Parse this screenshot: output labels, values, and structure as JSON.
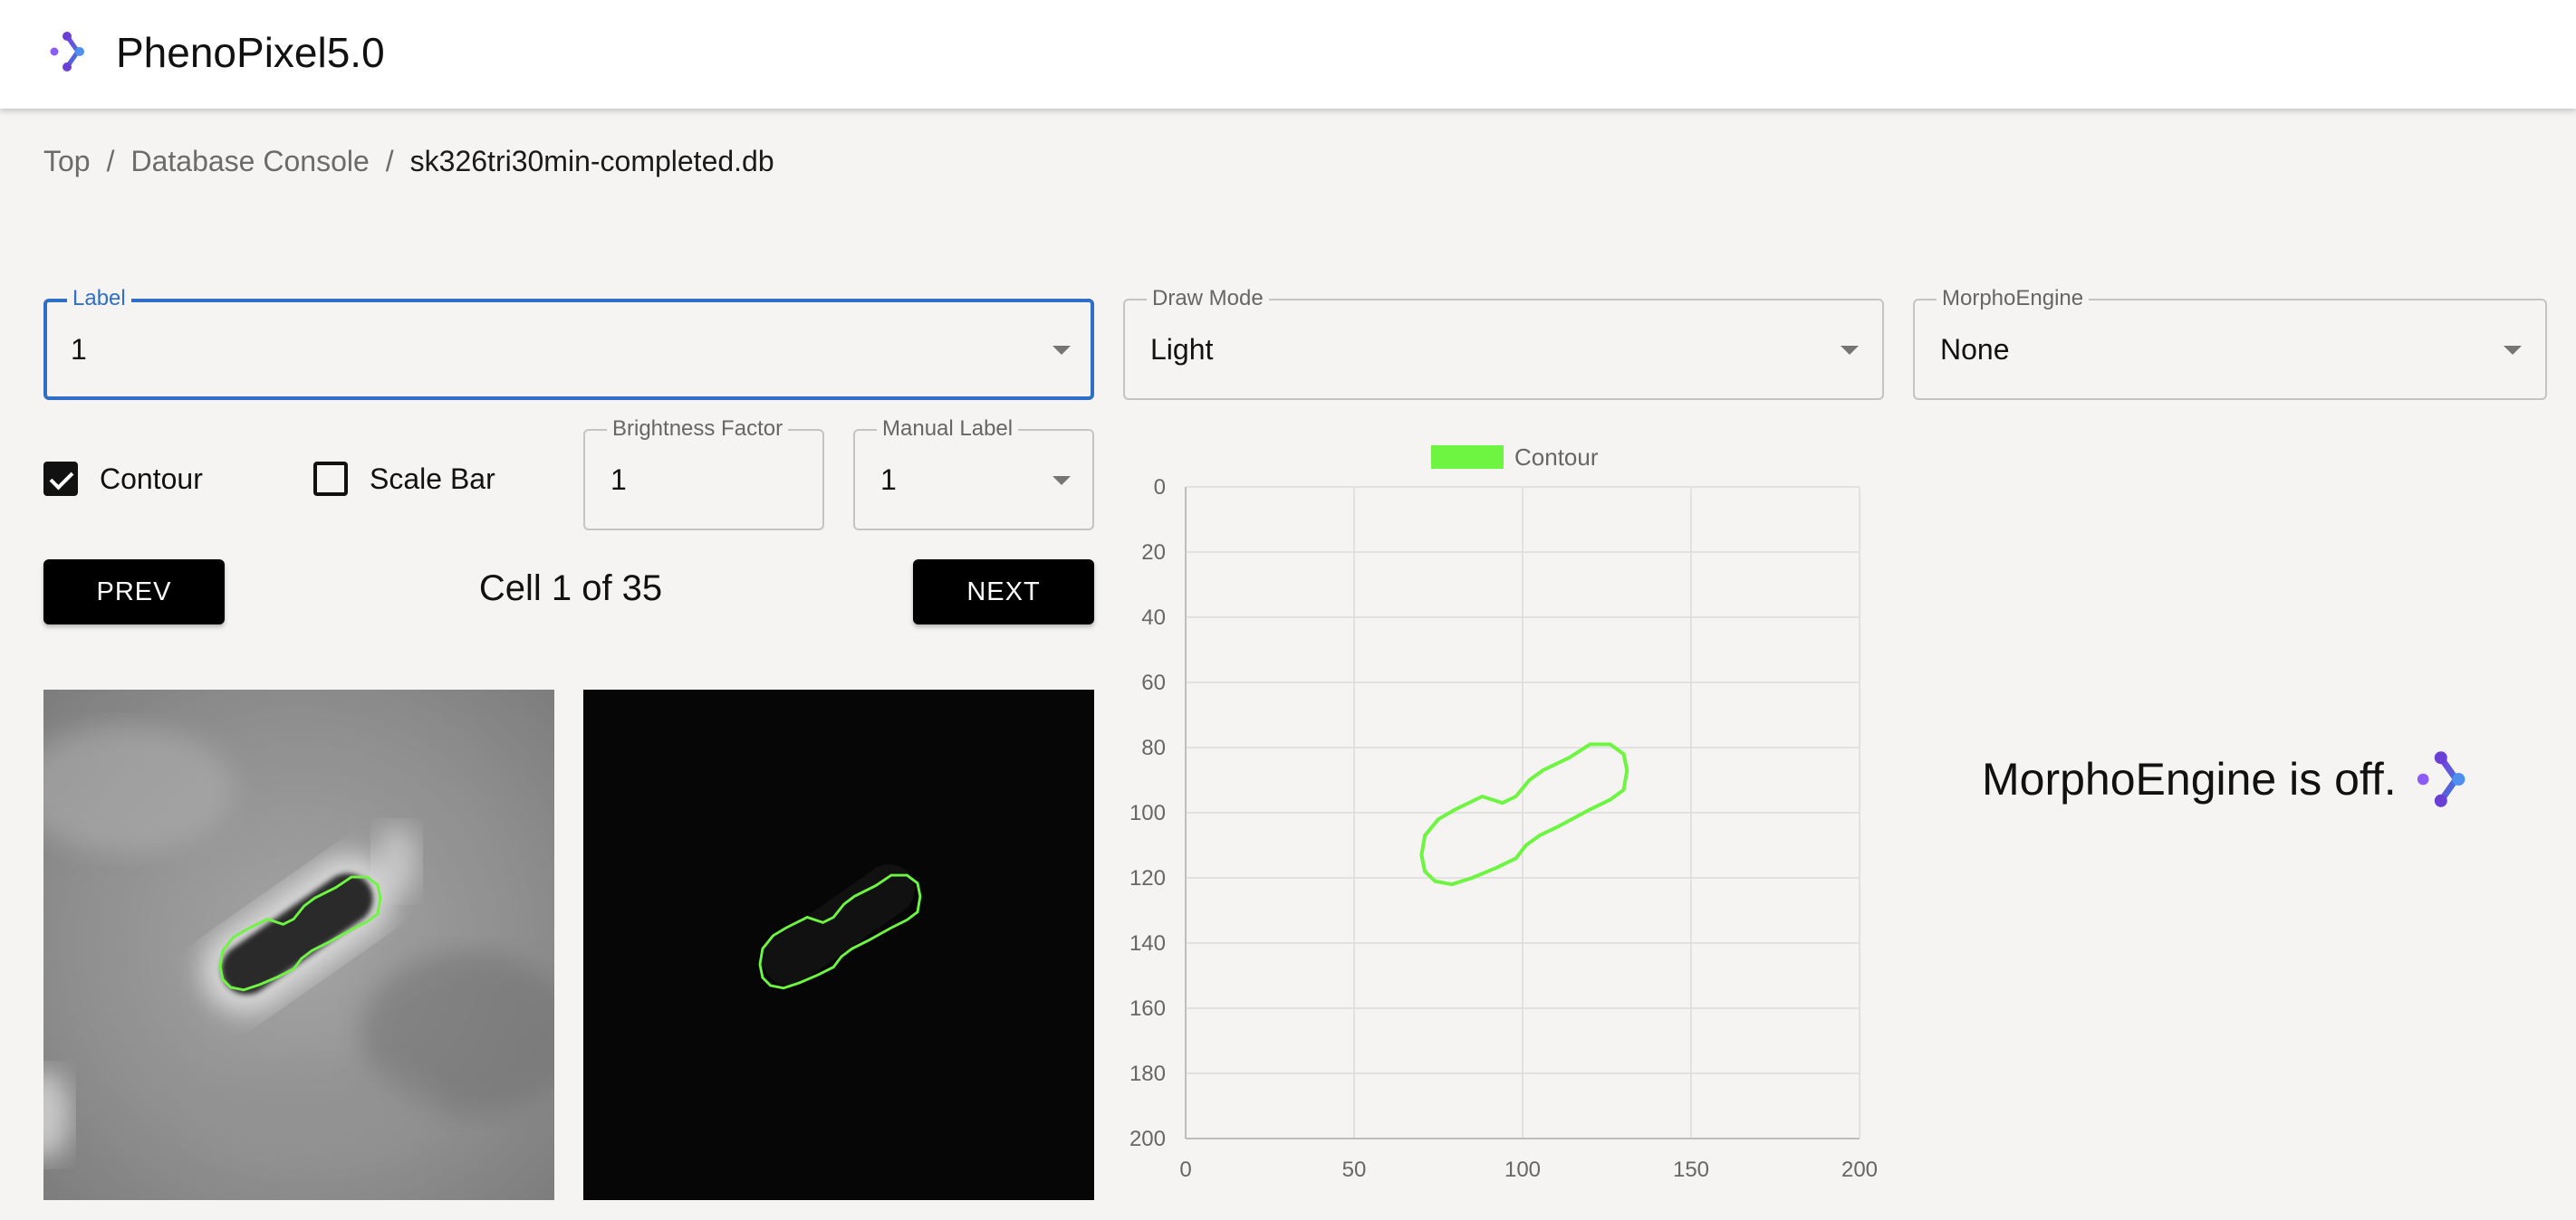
{
  "app": {
    "title": "PhenoPixel5.0",
    "logo_icon": "phenopixel-logo-icon"
  },
  "breadcrumb": {
    "items": [
      "Top",
      "Database Console",
      "sk326tri30min-completed.db"
    ],
    "separator": "/"
  },
  "controls": {
    "label": {
      "label": "Label",
      "value": "1"
    },
    "draw_mode": {
      "label": "Draw Mode",
      "value": "Light"
    },
    "morpho_engine": {
      "label": "MorphoEngine",
      "value": "None"
    },
    "contour": {
      "label": "Contour",
      "checked": true
    },
    "scale_bar": {
      "label": "Scale Bar",
      "checked": false
    },
    "brightness": {
      "label": "Brightness Factor",
      "value": "1"
    },
    "manual_label": {
      "label": "Manual Label",
      "value": "1"
    }
  },
  "navigation": {
    "prev_label": "PREV",
    "next_label": "NEXT",
    "counter_text": "Cell 1 of 35"
  },
  "morpho_status": {
    "text": "MorphoEngine is off."
  },
  "colors": {
    "accent": "#2f6fc7",
    "contour": "#6ef542",
    "button": "#000000",
    "background": "#f5f4f2"
  },
  "chart_data": {
    "type": "line",
    "legend": [
      "Contour"
    ],
    "legend_position": "top",
    "xlim": [
      0,
      200
    ],
    "ylim": [
      0,
      200
    ],
    "y_inverted": true,
    "grid": true,
    "x_ticks": [
      "0",
      "50",
      "100",
      "150",
      "200"
    ],
    "y_ticks": [
      "0",
      "20",
      "40",
      "60",
      "80",
      "100",
      "120",
      "140",
      "160",
      "180",
      "200"
    ],
    "series": [
      {
        "name": "Contour",
        "closed": true,
        "points": [
          [
            71,
            107
          ],
          [
            75,
            102
          ],
          [
            80,
            99
          ],
          [
            88,
            95
          ],
          [
            94,
            97
          ],
          [
            98,
            95
          ],
          [
            102,
            90
          ],
          [
            106,
            87
          ],
          [
            114,
            83
          ],
          [
            120,
            79
          ],
          [
            126,
            79
          ],
          [
            130,
            82
          ],
          [
            131,
            87
          ],
          [
            130,
            93
          ],
          [
            126,
            96
          ],
          [
            120,
            99
          ],
          [
            111,
            104
          ],
          [
            105,
            107
          ],
          [
            101,
            110
          ],
          [
            98,
            114
          ],
          [
            92,
            117
          ],
          [
            85,
            120
          ],
          [
            79,
            122
          ],
          [
            74,
            121
          ],
          [
            71,
            118
          ],
          [
            70,
            113
          ],
          [
            71,
            107
          ]
        ]
      }
    ]
  }
}
